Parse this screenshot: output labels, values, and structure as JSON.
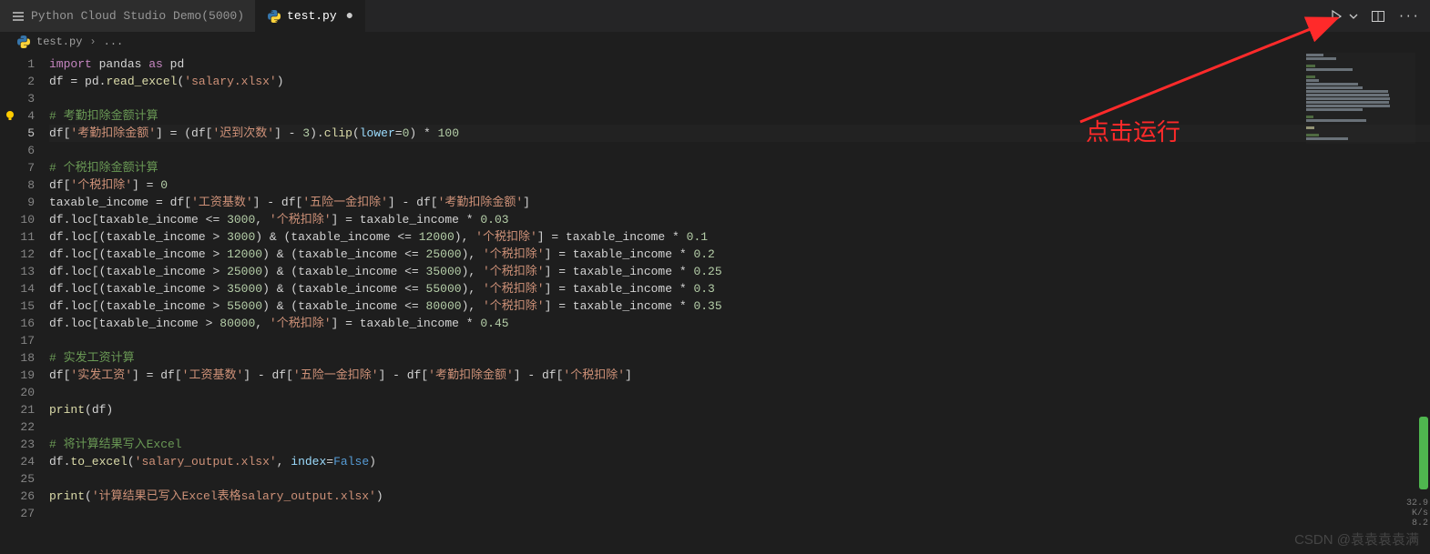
{
  "tabs": [
    {
      "icon": "menu-icon",
      "label": "Python Cloud Studio Demo(5000)",
      "active": false,
      "closable": false
    },
    {
      "icon": "python-file-icon",
      "label": "test.py",
      "active": true,
      "closable": true,
      "dirty": true
    }
  ],
  "breadcrumb": {
    "icon": "python-file-icon",
    "file": "test.py",
    "sep": "›",
    "more": "..."
  },
  "toolbar": {
    "run": "▷",
    "run_dropdown": "⌄",
    "split": "▢",
    "more": "···"
  },
  "gutter": {
    "total_lines": 27,
    "current_line": 5
  },
  "code_lines": [
    {
      "n": 1,
      "tokens": [
        [
          "kw",
          "import"
        ],
        [
          "op",
          " pandas "
        ],
        [
          "kw",
          "as"
        ],
        [
          "op",
          " pd"
        ]
      ]
    },
    {
      "n": 2,
      "tokens": [
        [
          "op",
          "df "
        ],
        [
          "op",
          "="
        ],
        [
          "op",
          " pd"
        ],
        [
          "op",
          "."
        ],
        [
          "fn",
          "read_excel"
        ],
        [
          "op",
          "("
        ],
        [
          "s",
          "'salary.xlsx'"
        ],
        [
          "op",
          ")"
        ]
      ]
    },
    {
      "n": 3,
      "tokens": []
    },
    {
      "n": 4,
      "bulb": true,
      "tokens": [
        [
          "cm",
          "# 考勤扣除金额计算"
        ]
      ]
    },
    {
      "n": 5,
      "hl": true,
      "tokens": [
        [
          "op",
          "df["
        ],
        [
          "s",
          "'考勤扣除金额'"
        ],
        [
          "op",
          "] "
        ],
        [
          "op",
          "="
        ],
        [
          "op",
          " (df["
        ],
        [
          "s",
          "'迟到次数'"
        ],
        [
          "op",
          "] "
        ],
        [
          "op",
          "-"
        ],
        [
          "op",
          " "
        ],
        [
          "n",
          "3"
        ],
        [
          "op",
          ")."
        ],
        [
          "fn",
          "clip"
        ],
        [
          "op",
          "("
        ],
        [
          "id",
          "lower"
        ],
        [
          "op",
          "="
        ],
        [
          "n",
          "0"
        ],
        [
          "op",
          ") "
        ],
        [
          "op",
          "*"
        ],
        [
          "op",
          " "
        ],
        [
          "n",
          "100"
        ]
      ]
    },
    {
      "n": 6,
      "tokens": []
    },
    {
      "n": 7,
      "tokens": [
        [
          "cm",
          "# 个税扣除金额计算"
        ]
      ]
    },
    {
      "n": 8,
      "tokens": [
        [
          "op",
          "df["
        ],
        [
          "s",
          "'个税扣除'"
        ],
        [
          "op",
          "] "
        ],
        [
          "op",
          "="
        ],
        [
          "op",
          " "
        ],
        [
          "n",
          "0"
        ]
      ]
    },
    {
      "n": 9,
      "tokens": [
        [
          "op",
          "taxable_income "
        ],
        [
          "op",
          "="
        ],
        [
          "op",
          " df["
        ],
        [
          "s",
          "'工资基数'"
        ],
        [
          "op",
          "] "
        ],
        [
          "op",
          "-"
        ],
        [
          "op",
          " df["
        ],
        [
          "s",
          "'五险一金扣除'"
        ],
        [
          "op",
          "] "
        ],
        [
          "op",
          "-"
        ],
        [
          "op",
          " df["
        ],
        [
          "s",
          "'考勤扣除金额'"
        ],
        [
          "op",
          "]"
        ]
      ]
    },
    {
      "n": 10,
      "tokens": [
        [
          "op",
          "df.loc[taxable_income "
        ],
        [
          "op",
          "<="
        ],
        [
          "op",
          " "
        ],
        [
          "n",
          "3000"
        ],
        [
          "op",
          ", "
        ],
        [
          "s",
          "'个税扣除'"
        ],
        [
          "op",
          "] "
        ],
        [
          "op",
          "="
        ],
        [
          "op",
          " taxable_income "
        ],
        [
          "op",
          "*"
        ],
        [
          "op",
          " "
        ],
        [
          "n",
          "0.03"
        ]
      ]
    },
    {
      "n": 11,
      "tokens": [
        [
          "op",
          "df.loc[(taxable_income "
        ],
        [
          "op",
          ">"
        ],
        [
          "op",
          " "
        ],
        [
          "n",
          "3000"
        ],
        [
          "op",
          ") "
        ],
        [
          "op",
          "&"
        ],
        [
          "op",
          " (taxable_income "
        ],
        [
          "op",
          "<="
        ],
        [
          "op",
          " "
        ],
        [
          "n",
          "12000"
        ],
        [
          "op",
          "), "
        ],
        [
          "s",
          "'个税扣除'"
        ],
        [
          "op",
          "] "
        ],
        [
          "op",
          "="
        ],
        [
          "op",
          " taxable_income "
        ],
        [
          "op",
          "*"
        ],
        [
          "op",
          " "
        ],
        [
          "n",
          "0.1"
        ]
      ]
    },
    {
      "n": 12,
      "tokens": [
        [
          "op",
          "df.loc[(taxable_income "
        ],
        [
          "op",
          ">"
        ],
        [
          "op",
          " "
        ],
        [
          "n",
          "12000"
        ],
        [
          "op",
          ") "
        ],
        [
          "op",
          "&"
        ],
        [
          "op",
          " (taxable_income "
        ],
        [
          "op",
          "<="
        ],
        [
          "op",
          " "
        ],
        [
          "n",
          "25000"
        ],
        [
          "op",
          "), "
        ],
        [
          "s",
          "'个税扣除'"
        ],
        [
          "op",
          "] "
        ],
        [
          "op",
          "="
        ],
        [
          "op",
          " taxable_income "
        ],
        [
          "op",
          "*"
        ],
        [
          "op",
          " "
        ],
        [
          "n",
          "0.2"
        ]
      ]
    },
    {
      "n": 13,
      "tokens": [
        [
          "op",
          "df.loc[(taxable_income "
        ],
        [
          "op",
          ">"
        ],
        [
          "op",
          " "
        ],
        [
          "n",
          "25000"
        ],
        [
          "op",
          ") "
        ],
        [
          "op",
          "&"
        ],
        [
          "op",
          " (taxable_income "
        ],
        [
          "op",
          "<="
        ],
        [
          "op",
          " "
        ],
        [
          "n",
          "35000"
        ],
        [
          "op",
          "), "
        ],
        [
          "s",
          "'个税扣除'"
        ],
        [
          "op",
          "] "
        ],
        [
          "op",
          "="
        ],
        [
          "op",
          " taxable_income "
        ],
        [
          "op",
          "*"
        ],
        [
          "op",
          " "
        ],
        [
          "n",
          "0.25"
        ]
      ]
    },
    {
      "n": 14,
      "tokens": [
        [
          "op",
          "df.loc[(taxable_income "
        ],
        [
          "op",
          ">"
        ],
        [
          "op",
          " "
        ],
        [
          "n",
          "35000"
        ],
        [
          "op",
          ") "
        ],
        [
          "op",
          "&"
        ],
        [
          "op",
          " (taxable_income "
        ],
        [
          "op",
          "<="
        ],
        [
          "op",
          " "
        ],
        [
          "n",
          "55000"
        ],
        [
          "op",
          "), "
        ],
        [
          "s",
          "'个税扣除'"
        ],
        [
          "op",
          "] "
        ],
        [
          "op",
          "="
        ],
        [
          "op",
          " taxable_income "
        ],
        [
          "op",
          "*"
        ],
        [
          "op",
          " "
        ],
        [
          "n",
          "0.3"
        ]
      ]
    },
    {
      "n": 15,
      "tokens": [
        [
          "op",
          "df.loc[(taxable_income "
        ],
        [
          "op",
          ">"
        ],
        [
          "op",
          " "
        ],
        [
          "n",
          "55000"
        ],
        [
          "op",
          ") "
        ],
        [
          "op",
          "&"
        ],
        [
          "op",
          " (taxable_income "
        ],
        [
          "op",
          "<="
        ],
        [
          "op",
          " "
        ],
        [
          "n",
          "80000"
        ],
        [
          "op",
          "), "
        ],
        [
          "s",
          "'个税扣除'"
        ],
        [
          "op",
          "] "
        ],
        [
          "op",
          "="
        ],
        [
          "op",
          " taxable_income "
        ],
        [
          "op",
          "*"
        ],
        [
          "op",
          " "
        ],
        [
          "n",
          "0.35"
        ]
      ]
    },
    {
      "n": 16,
      "tokens": [
        [
          "op",
          "df.loc[taxable_income "
        ],
        [
          "op",
          ">"
        ],
        [
          "op",
          " "
        ],
        [
          "n",
          "80000"
        ],
        [
          "op",
          ", "
        ],
        [
          "s",
          "'个税扣除'"
        ],
        [
          "op",
          "] "
        ],
        [
          "op",
          "="
        ],
        [
          "op",
          " taxable_income "
        ],
        [
          "op",
          "*"
        ],
        [
          "op",
          " "
        ],
        [
          "n",
          "0.45"
        ]
      ]
    },
    {
      "n": 17,
      "tokens": []
    },
    {
      "n": 18,
      "tokens": [
        [
          "cm",
          "# 实发工资计算"
        ]
      ]
    },
    {
      "n": 19,
      "tokens": [
        [
          "op",
          "df["
        ],
        [
          "s",
          "'实发工资'"
        ],
        [
          "op",
          "] "
        ],
        [
          "op",
          "="
        ],
        [
          "op",
          " df["
        ],
        [
          "s",
          "'工资基数'"
        ],
        [
          "op",
          "] "
        ],
        [
          "op",
          "-"
        ],
        [
          "op",
          " df["
        ],
        [
          "s",
          "'五险一金扣除'"
        ],
        [
          "op",
          "] "
        ],
        [
          "op",
          "-"
        ],
        [
          "op",
          " df["
        ],
        [
          "s",
          "'考勤扣除金额'"
        ],
        [
          "op",
          "] "
        ],
        [
          "op",
          "-"
        ],
        [
          "op",
          " df["
        ],
        [
          "s",
          "'个税扣除'"
        ],
        [
          "op",
          "]"
        ]
      ]
    },
    {
      "n": 20,
      "tokens": []
    },
    {
      "n": 21,
      "tokens": [
        [
          "fn",
          "print"
        ],
        [
          "op",
          "(df)"
        ]
      ]
    },
    {
      "n": 22,
      "tokens": []
    },
    {
      "n": 23,
      "tokens": [
        [
          "cm",
          "# 将计算结果写入Excel"
        ]
      ]
    },
    {
      "n": 24,
      "tokens": [
        [
          "op",
          "df."
        ],
        [
          "fn",
          "to_excel"
        ],
        [
          "op",
          "("
        ],
        [
          "s",
          "'salary_output.xlsx'"
        ],
        [
          "op",
          ", "
        ],
        [
          "id",
          "index"
        ],
        [
          "op",
          "="
        ],
        [
          "cf",
          "False"
        ],
        [
          "op",
          ")"
        ]
      ]
    },
    {
      "n": 25,
      "tokens": []
    },
    {
      "n": 26,
      "tokens": [
        [
          "fn",
          "print"
        ],
        [
          "op",
          "("
        ],
        [
          "s",
          "'计算结果已写入Excel表格salary_output.xlsx'"
        ],
        [
          "op",
          ")"
        ]
      ]
    },
    {
      "n": 27,
      "tokens": []
    }
  ],
  "annotation": {
    "text": "点击运行"
  },
  "watermark": "CSDN @袁袁袁袁满",
  "net_stats": {
    "down": "32.9",
    "up": "8.2",
    "unit": "K/s"
  }
}
